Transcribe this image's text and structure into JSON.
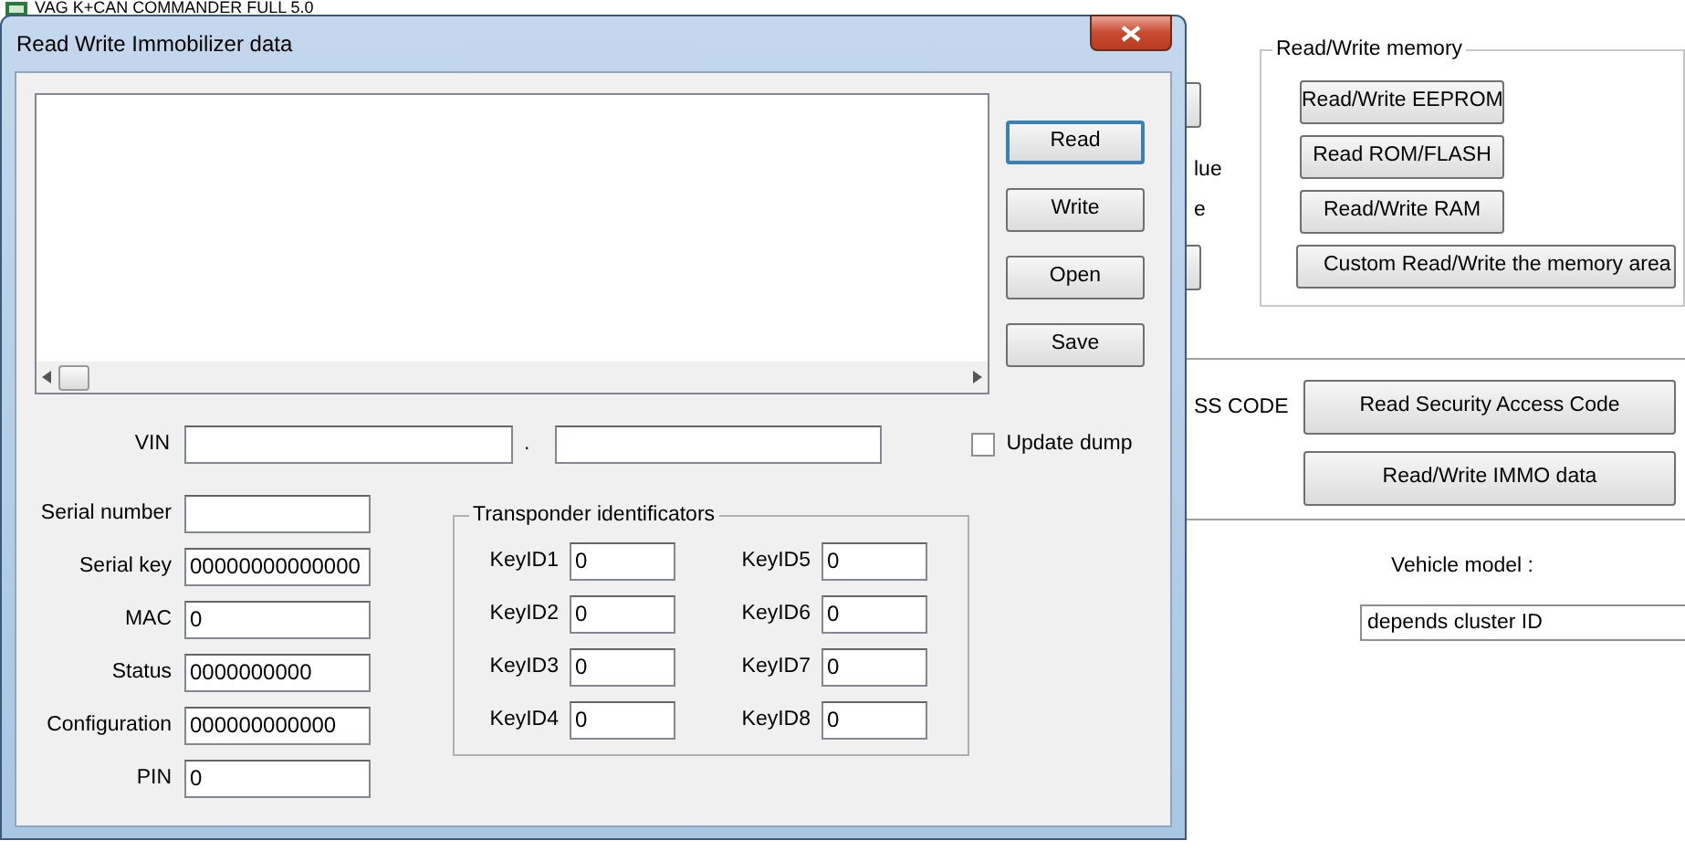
{
  "background_window": {
    "title": "VAG K+CAN COMMANDER FULL 5.0",
    "fragments": [
      "lue",
      "e"
    ],
    "memory_group": {
      "title": "Read/Write memory",
      "buttons": [
        "Read/Write EEPROM",
        "Read ROM/FLASH",
        "Read/Write RAM",
        "Custom Read/Write the memory area"
      ]
    },
    "access_label": "SS CODE",
    "access_buttons": [
      "Read Security Access Code",
      "Read/Write IMMO data"
    ],
    "vehicle_model": {
      "label": "Vehicle model :",
      "value": "depends cluster ID"
    }
  },
  "dialog": {
    "title": "Read Write Immobilizer data",
    "buttons": [
      {
        "label": "Read",
        "default": true
      },
      {
        "label": "Write",
        "default": false
      },
      {
        "label": "Open",
        "default": false
      },
      {
        "label": "Save",
        "default": false
      }
    ],
    "vin": {
      "label": "VIN",
      "separator": "."
    },
    "update_dump": {
      "label": "Update dump",
      "checked": false
    },
    "fields": [
      {
        "label": "Serial number"
      },
      {
        "label": "Serial key",
        "value": "00000000000000"
      },
      {
        "label": "MAC",
        "value": "0"
      },
      {
        "label": "Status",
        "value": "0000000000"
      },
      {
        "label": "Configuration",
        "value": "000000000000"
      },
      {
        "label": "PIN",
        "value": "0"
      }
    ],
    "transponder": {
      "title": "Transponder identificators",
      "keys": [
        {
          "label": "KeyID1",
          "value": "0"
        },
        {
          "label": "KeyID2",
          "value": "0"
        },
        {
          "label": "KeyID3",
          "value": "0"
        },
        {
          "label": "KeyID4",
          "value": "0"
        },
        {
          "label": "KeyID5",
          "value": "0"
        },
        {
          "label": "KeyID6",
          "value": "0"
        },
        {
          "label": "KeyID7",
          "value": "0"
        },
        {
          "label": "KeyID8",
          "value": "0"
        }
      ]
    }
  }
}
